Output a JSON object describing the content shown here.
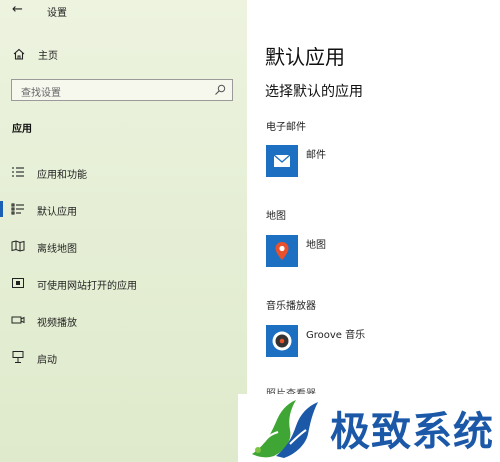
{
  "window": {
    "title": "设置",
    "back_icon": "back-arrow-icon"
  },
  "sidebar": {
    "home_label": "主页",
    "search_placeholder": "查找设置",
    "section_heading": "应用",
    "items": [
      {
        "label": "应用和功能",
        "icon": "apps-features-icon",
        "selected": false
      },
      {
        "label": "默认应用",
        "icon": "default-apps-icon",
        "selected": true
      },
      {
        "label": "离线地图",
        "icon": "offline-maps-icon",
        "selected": false
      },
      {
        "label": "可使用网站打开的应用",
        "icon": "apps-for-websites-icon",
        "selected": false
      },
      {
        "label": "视频播放",
        "icon": "video-playback-icon",
        "selected": false
      },
      {
        "label": "启动",
        "icon": "startup-icon",
        "selected": false
      }
    ]
  },
  "main": {
    "title": "默认应用",
    "subtitle": "选择默认的应用",
    "sections": [
      {
        "category": "电子邮件",
        "app": "邮件",
        "icon": "mail-icon"
      },
      {
        "category": "地图",
        "app": "地图",
        "icon": "maps-icon"
      },
      {
        "category": "音乐播放器",
        "app": "Groove 音乐",
        "icon": "groove-music-icon"
      }
    ],
    "cut_off_label": "照片查看器"
  },
  "watermark": {
    "text": "极致系统"
  },
  "colors": {
    "accent": "#1b5fb5",
    "tile": "#1c6fc1",
    "sidebar_bg": "#e6efd6"
  }
}
